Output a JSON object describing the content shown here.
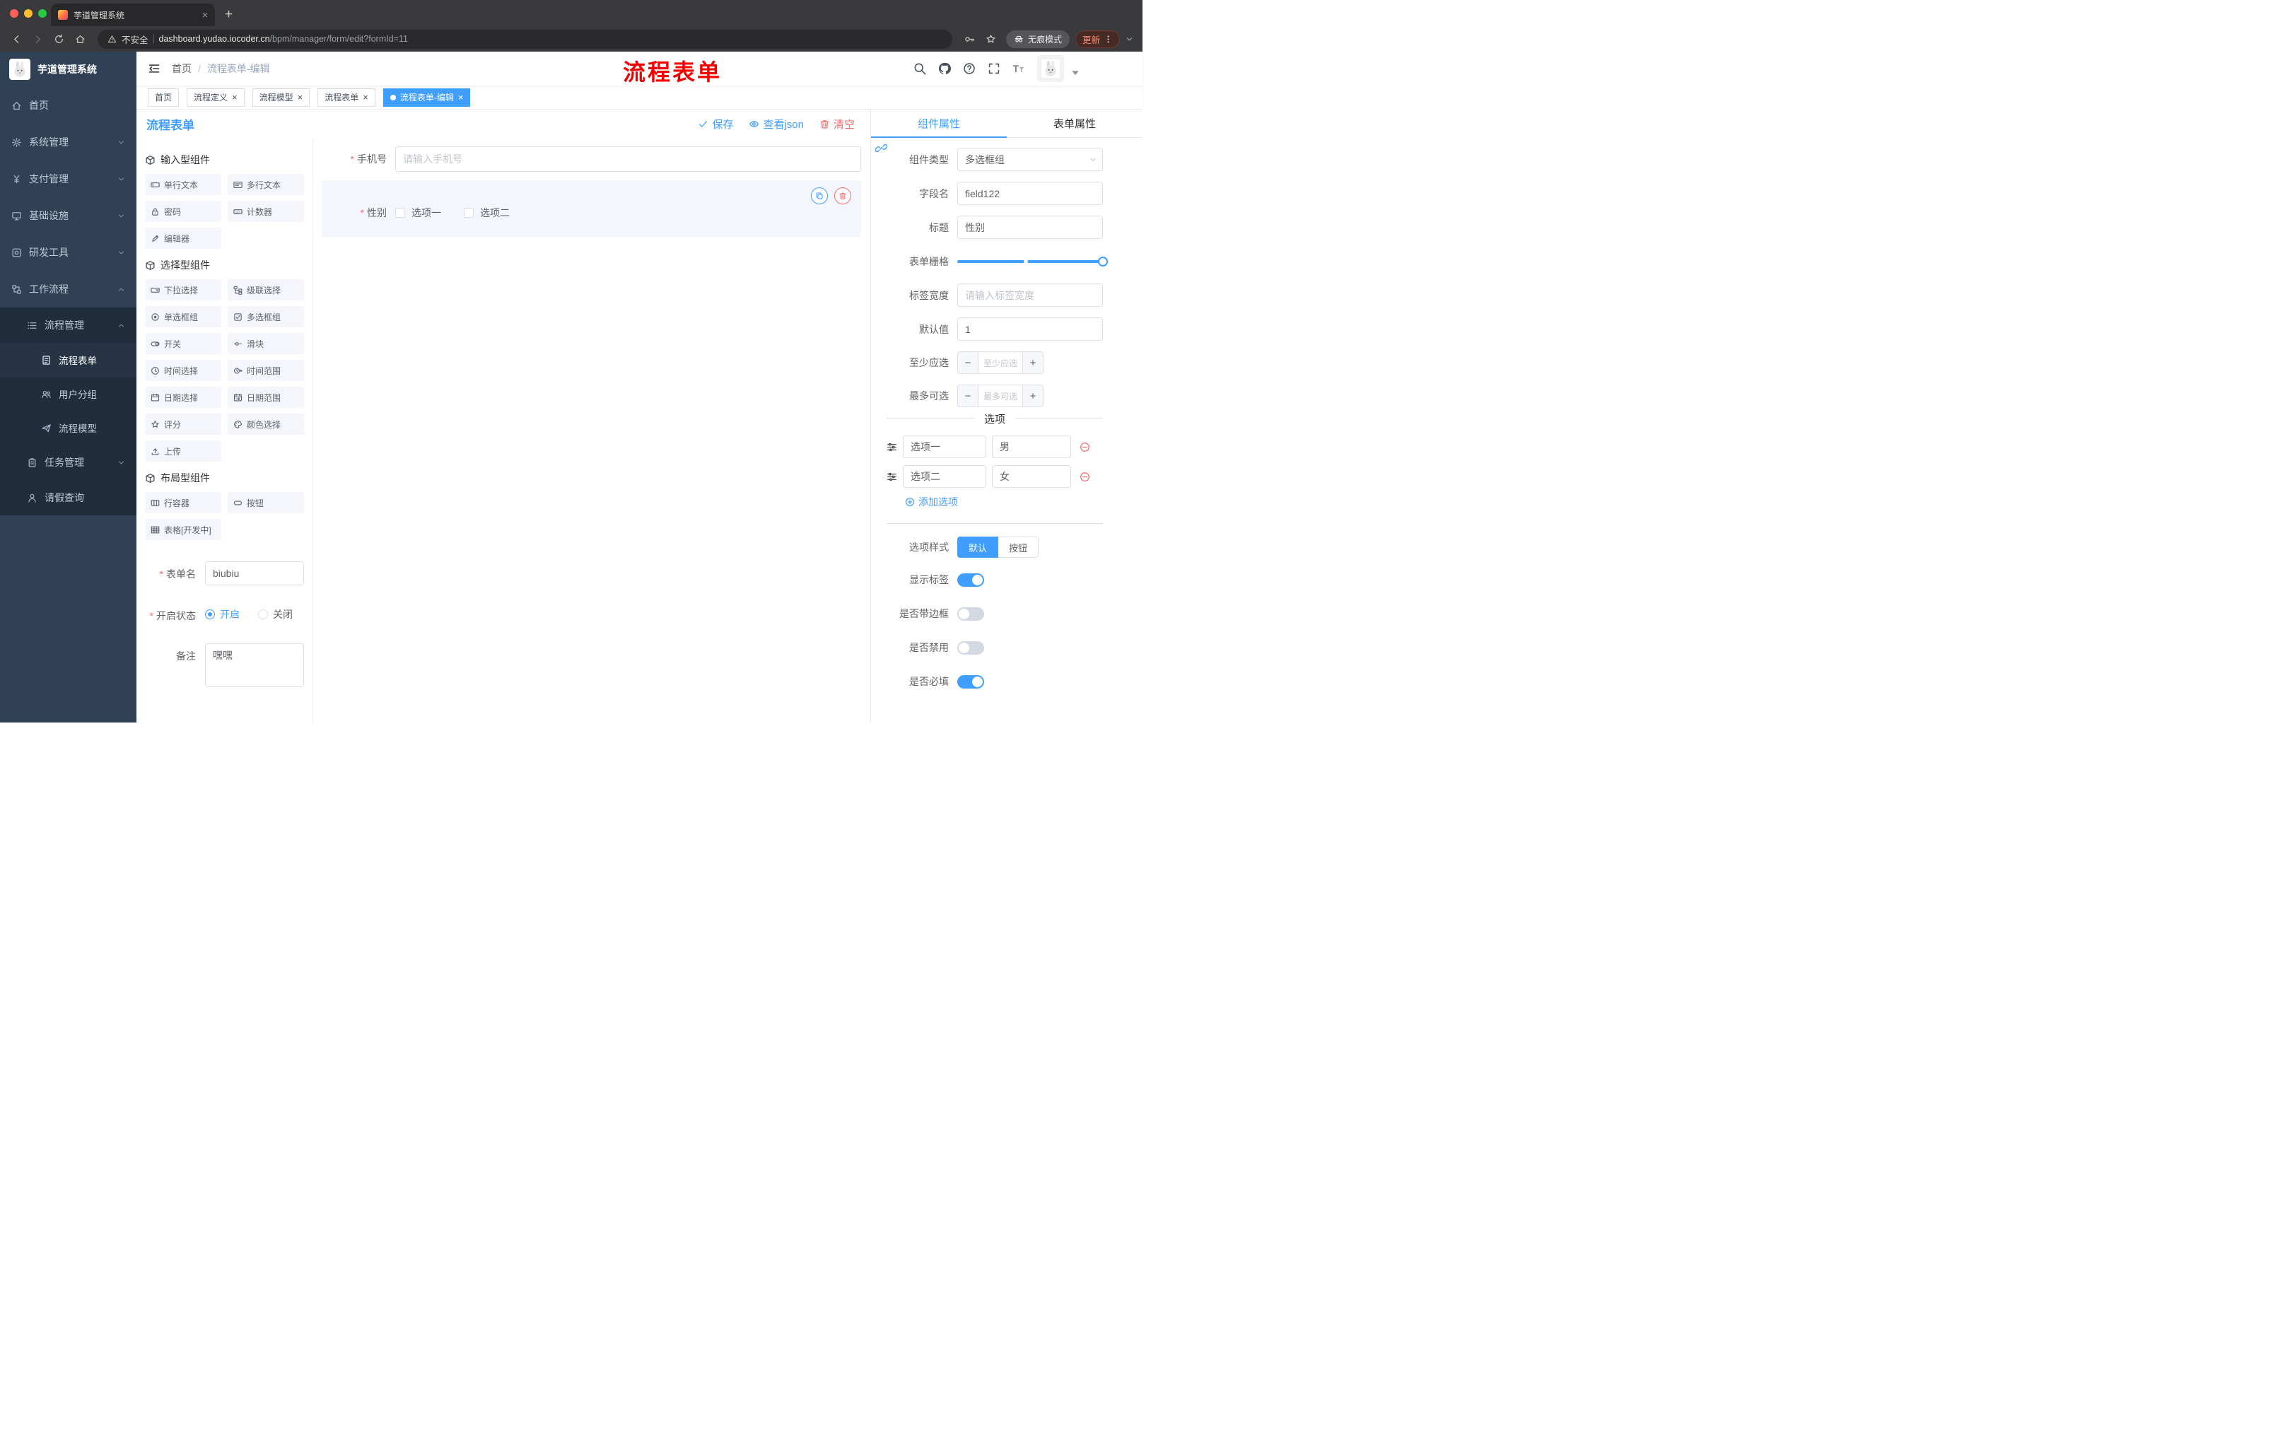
{
  "colors": {
    "accent": "#409EFF",
    "danger": "#F56C6C",
    "sidebar_bg": "#304156",
    "annotation_red": "#F40000",
    "update_orange": "#FF8A70"
  },
  "browser": {
    "tab_title": "芋道管理系统",
    "security": "不安全",
    "url_host": "dashboard.yudao.iocoder.cn",
    "url_path": "/bpm/manager/form/edit?formId=11",
    "incognito": "无痕模式",
    "update": "更新"
  },
  "sidebar": {
    "title": "芋道管理系统",
    "items": [
      {
        "icon": "home-icon",
        "label": "首页",
        "level": 1
      },
      {
        "icon": "gear-icon",
        "label": "系统管理",
        "level": 1,
        "chevron": "down"
      },
      {
        "icon": "yen-icon",
        "label": "支付管理",
        "level": 1,
        "chevron": "down"
      },
      {
        "icon": "infra-icon",
        "label": "基础设施",
        "level": 1,
        "chevron": "down"
      },
      {
        "icon": "tools-icon",
        "label": "研发工具",
        "level": 1,
        "chevron": "down"
      },
      {
        "icon": "workflow-icon",
        "label": "工作流程",
        "level": 1,
        "chevron": "up"
      },
      {
        "icon": "flow-manage-icon",
        "label": "流程管理",
        "level": 2,
        "chevron": "up"
      },
      {
        "icon": "form-icon",
        "label": "流程表单",
        "level": 3,
        "active": true
      },
      {
        "icon": "group-icon",
        "label": "用户分组",
        "level": 3
      },
      {
        "icon": "model-icon",
        "label": "流程模型",
        "level": 3
      },
      {
        "icon": "task-icon",
        "label": "任务管理",
        "level": 2,
        "chevron": "down"
      },
      {
        "icon": "leave-icon",
        "label": "请假查询",
        "level": 2
      }
    ]
  },
  "header": {
    "breadcrumb": [
      "首页",
      "流程表单-编辑"
    ],
    "annotation": "流程表单"
  },
  "tags": [
    {
      "label": "首页",
      "closable": false,
      "active": false
    },
    {
      "label": "流程定义",
      "closable": true,
      "active": false
    },
    {
      "label": "流程模型",
      "closable": true,
      "active": false
    },
    {
      "label": "流程表单",
      "closable": true,
      "active": false
    },
    {
      "label": "流程表单-编辑",
      "closable": true,
      "active": true
    }
  ],
  "editor": {
    "title": "流程表单",
    "actions": [
      {
        "name": "save-button",
        "icon": "check-icon",
        "label": "保存",
        "color": "blue"
      },
      {
        "name": "view-json-button",
        "icon": "eye-icon",
        "label": "查看json",
        "color": "blue"
      },
      {
        "name": "clear-button",
        "icon": "trash-icon",
        "label": "清空",
        "color": "red"
      }
    ],
    "palette": [
      {
        "title": "输入型组件",
        "items": [
          {
            "icon": "input-icon",
            "label": "单行文本"
          },
          {
            "icon": "textarea-icon",
            "label": "多行文本"
          },
          {
            "icon": "password-icon",
            "label": "密码"
          },
          {
            "icon": "counter-icon",
            "label": "计数器"
          },
          {
            "icon": "editor-icon",
            "label": "编辑器"
          }
        ]
      },
      {
        "title": "选择型组件",
        "items": [
          {
            "icon": "select-icon",
            "label": "下拉选择"
          },
          {
            "icon": "cascader-icon",
            "label": "级联选择"
          },
          {
            "icon": "radio-icon",
            "label": "单选框组"
          },
          {
            "icon": "checkbox-icon",
            "label": "多选框组"
          },
          {
            "icon": "switch-icon",
            "label": "开关"
          },
          {
            "icon": "slider-icon",
            "label": "滑块"
          },
          {
            "icon": "time-icon",
            "label": "时间选择"
          },
          {
            "icon": "time-range-icon",
            "label": "时间范围"
          },
          {
            "icon": "date-icon",
            "label": "日期选择"
          },
          {
            "icon": "date-range-icon",
            "label": "日期范围"
          },
          {
            "icon": "rate-icon",
            "label": "评分"
          },
          {
            "icon": "color-icon",
            "label": "颜色选择"
          },
          {
            "icon": "upload-icon",
            "label": "上传"
          }
        ]
      },
      {
        "title": "布局型组件",
        "items": [
          {
            "icon": "row-icon",
            "label": "行容器"
          },
          {
            "icon": "button-icon",
            "label": "按钮"
          },
          {
            "icon": "table-icon",
            "label": "表格[开发中]"
          }
        ]
      }
    ],
    "form_meta": {
      "name_label": "表单名",
      "name_value": "biubiu",
      "status_label": "开启状态",
      "status_options": [
        {
          "label": "开启",
          "selected": true
        },
        {
          "label": "关闭",
          "selected": false
        }
      ],
      "remark_label": "备注",
      "remark_value": "嘿嘿"
    },
    "canvas": {
      "fields": [
        {
          "label": "手机号",
          "required": true,
          "type": "input",
          "placeholder": "请输入手机号"
        },
        {
          "label": "性别",
          "required": true,
          "type": "checkbox-group",
          "selected": true,
          "options": [
            "选项一",
            "选项二"
          ]
        }
      ]
    }
  },
  "properties": {
    "tabs": [
      {
        "label": "组件属性",
        "active": true
      },
      {
        "label": "表单属性",
        "active": false
      }
    ],
    "fields": [
      {
        "label": "组件类型",
        "type": "select",
        "value": "多选框组"
      },
      {
        "label": "字段名",
        "type": "input",
        "value": "field122"
      },
      {
        "label": "标题",
        "type": "input",
        "value": "性别"
      },
      {
        "label": "表单栅格",
        "type": "slider",
        "percent": 100,
        "mark_percent": 47
      },
      {
        "label": "标签宽度",
        "type": "input",
        "placeholder": "请输入标签宽度"
      },
      {
        "label": "默认值",
        "type": "input",
        "value": "1"
      },
      {
        "label": "至少应选",
        "type": "stepper",
        "placeholder": "至少应选"
      },
      {
        "label": "最多可选",
        "type": "stepper",
        "placeholder": "最多可选"
      }
    ],
    "options_divider": "选项",
    "options": [
      {
        "name": "选项一",
        "value": "男"
      },
      {
        "name": "选项二",
        "value": "女"
      }
    ],
    "add_option": "添加选项",
    "style_label": "选项样式",
    "style_buttons": [
      {
        "label": "默认",
        "active": true
      },
      {
        "label": "按钮",
        "active": false
      }
    ],
    "switches": [
      {
        "label": "显示标签",
        "on": true
      },
      {
        "label": "是否带边框",
        "on": false
      },
      {
        "label": "是否禁用",
        "on": false
      },
      {
        "label": "是否必填",
        "on": true
      }
    ]
  }
}
